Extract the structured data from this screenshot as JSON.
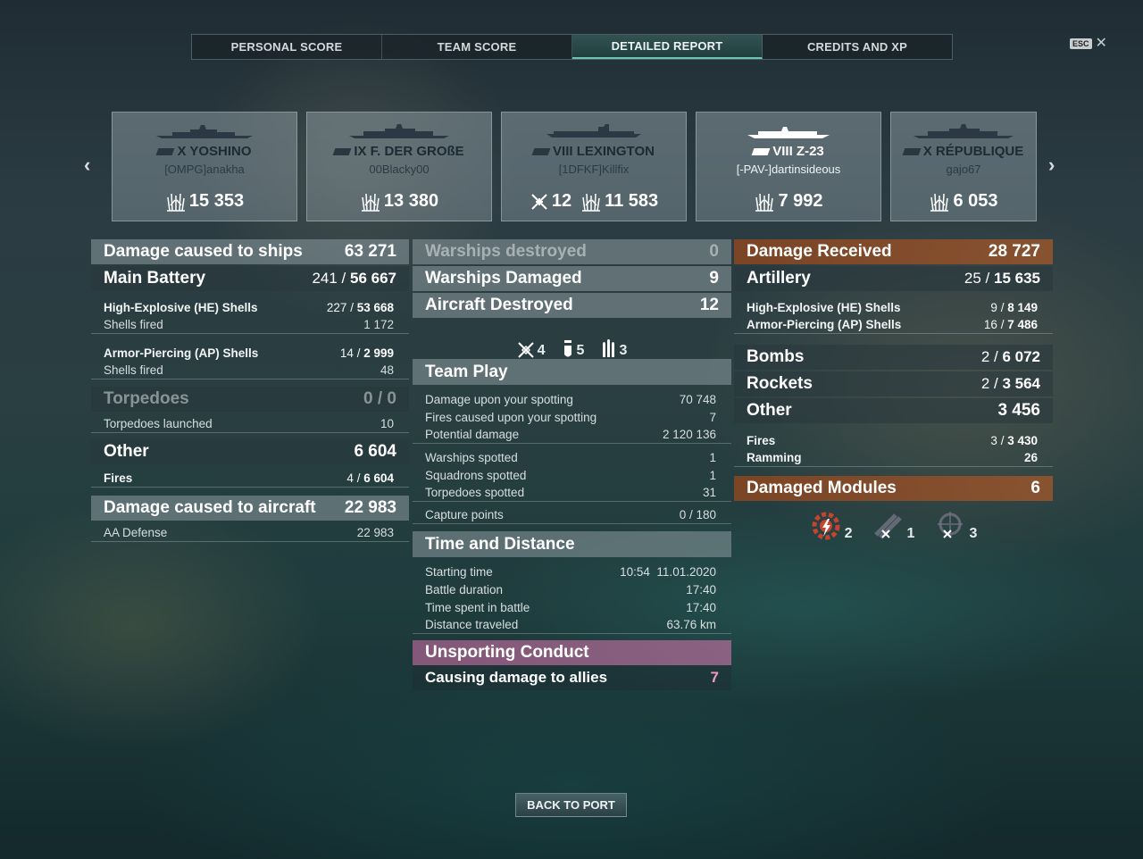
{
  "tabs": [
    "PERSONAL SCORE",
    "TEAM SCORE",
    "DETAILED REPORT",
    "CREDITS AND XP"
  ],
  "active_tab": "DETAILED REPORT",
  "esc_label": "ESC",
  "close_glyph": "✕",
  "nav": {
    "prev": "‹",
    "next": "›"
  },
  "ships": [
    {
      "name": "X YOSHINO",
      "player": "[OMPG]anakha",
      "stats": [
        {
          "icon": "damage-icon",
          "value": "15 353"
        }
      ]
    },
    {
      "name": "IX F. DER GROßE",
      "player": "00Blacky00",
      "stats": [
        {
          "icon": "damage-icon",
          "value": "13 380"
        }
      ]
    },
    {
      "name": "VIII LEXINGTON",
      "player": "[1DFKF]Killfix",
      "stats": [
        {
          "icon": "aircraft-kill-icon",
          "value": "12"
        },
        {
          "icon": "damage-icon",
          "value": "11 583"
        }
      ]
    },
    {
      "name": "VIII Z-23",
      "player": "[-PAV-]dartinsideous",
      "stats": [
        {
          "icon": "damage-icon",
          "value": "7 992"
        }
      ]
    },
    {
      "name": "X RÉPUBLIQUE",
      "player": "gajo67",
      "stats": [
        {
          "icon": "damage-icon",
          "value": "6 053"
        }
      ]
    }
  ],
  "left": {
    "damage_ships": {
      "label": "Damage caused to ships",
      "value": "63 271"
    },
    "main_battery": {
      "label": "Main Battery",
      "hits": "241",
      "value": "56 667"
    },
    "he": {
      "label": "High-Explosive (HE) Shells",
      "hits": "227",
      "value": "53 668"
    },
    "he_fired": {
      "label": "Shells fired",
      "value": "1 172"
    },
    "ap": {
      "label": "Armor-Piercing (AP) Shells",
      "hits": "14",
      "value": "2 999"
    },
    "ap_fired": {
      "label": "Shells fired",
      "value": "48"
    },
    "torpedoes": {
      "label": "Torpedoes",
      "value": "0 / 0"
    },
    "torp_launched": {
      "label": "Torpedoes launched",
      "value": "10"
    },
    "other": {
      "label": "Other",
      "value": "6 604"
    },
    "fires": {
      "label": "Fires",
      "hits": "4",
      "value": "6 604"
    },
    "damage_aircraft": {
      "label": "Damage caused to aircraft",
      "value": "22 983"
    },
    "aa": {
      "label": "AA Defense",
      "value": "22 983"
    }
  },
  "middle": {
    "warships_destroyed": {
      "label": "Warships destroyed",
      "value": "0"
    },
    "warships_damaged": {
      "label": "Warships Damaged",
      "value": "9"
    },
    "aircraft_destroyed": {
      "label": "Aircraft Destroyed",
      "value": "12"
    },
    "aircraft_icons": [
      {
        "icon": "fighter-kill-icon",
        "value": "4"
      },
      {
        "icon": "bomber-kill-icon",
        "value": "5"
      },
      {
        "icon": "torpedo-bomber-kill-icon",
        "value": "3"
      }
    ],
    "team_play": {
      "title": "Team Play",
      "rows": [
        {
          "label": "Damage upon your spotting",
          "value": "70 748"
        },
        {
          "label": "Fires caused upon your spotting",
          "value": "7"
        },
        {
          "label": "Potential damage",
          "value": "2 120 136"
        },
        {
          "label": "Warships spotted",
          "value": "1"
        },
        {
          "label": "Squadrons spotted",
          "value": "1"
        },
        {
          "label": "Torpedoes spotted",
          "value": "31"
        },
        {
          "label": "Capture points",
          "value": "0 / 180"
        }
      ]
    },
    "time": {
      "title": "Time and Distance",
      "rows": [
        {
          "label": "Starting time",
          "value": "10:54  11.01.2020"
        },
        {
          "label": "Battle duration",
          "value": "17:40"
        },
        {
          "label": "Time spent in battle",
          "value": "17:40"
        },
        {
          "label": "Distance traveled",
          "value": "63.76 km"
        }
      ]
    },
    "unsporting": {
      "title": "Unsporting Conduct",
      "label": "Causing damage to allies",
      "value": "7"
    }
  },
  "right": {
    "damage_received": {
      "label": "Damage Received",
      "value": "28 727"
    },
    "artillery": {
      "label": "Artillery",
      "hits": "25",
      "value": "15 635"
    },
    "he": {
      "label": "High-Explosive (HE) Shells",
      "hits": "9",
      "value": "8 149"
    },
    "ap": {
      "label": "Armor-Piercing (AP) Shells",
      "hits": "16",
      "value": "7 486"
    },
    "bombs": {
      "label": "Bombs",
      "hits": "2",
      "value": "6 072"
    },
    "rockets": {
      "label": "Rockets",
      "hits": "2",
      "value": "3 564"
    },
    "other": {
      "label": "Other",
      "value": "3 456"
    },
    "fires": {
      "label": "Fires",
      "hits": "3",
      "value": "3 430"
    },
    "ramming": {
      "label": "Ramming",
      "value": "26"
    },
    "damaged_modules": {
      "label": "Damaged Modules",
      "value": "6"
    },
    "modules": [
      {
        "icon": "engine-damaged-icon",
        "value": "2"
      },
      {
        "icon": "guns-damaged-icon",
        "value": "1"
      },
      {
        "icon": "steering-damaged-icon",
        "value": "3"
      }
    ]
  },
  "back_button": "BACK TO PORT"
}
